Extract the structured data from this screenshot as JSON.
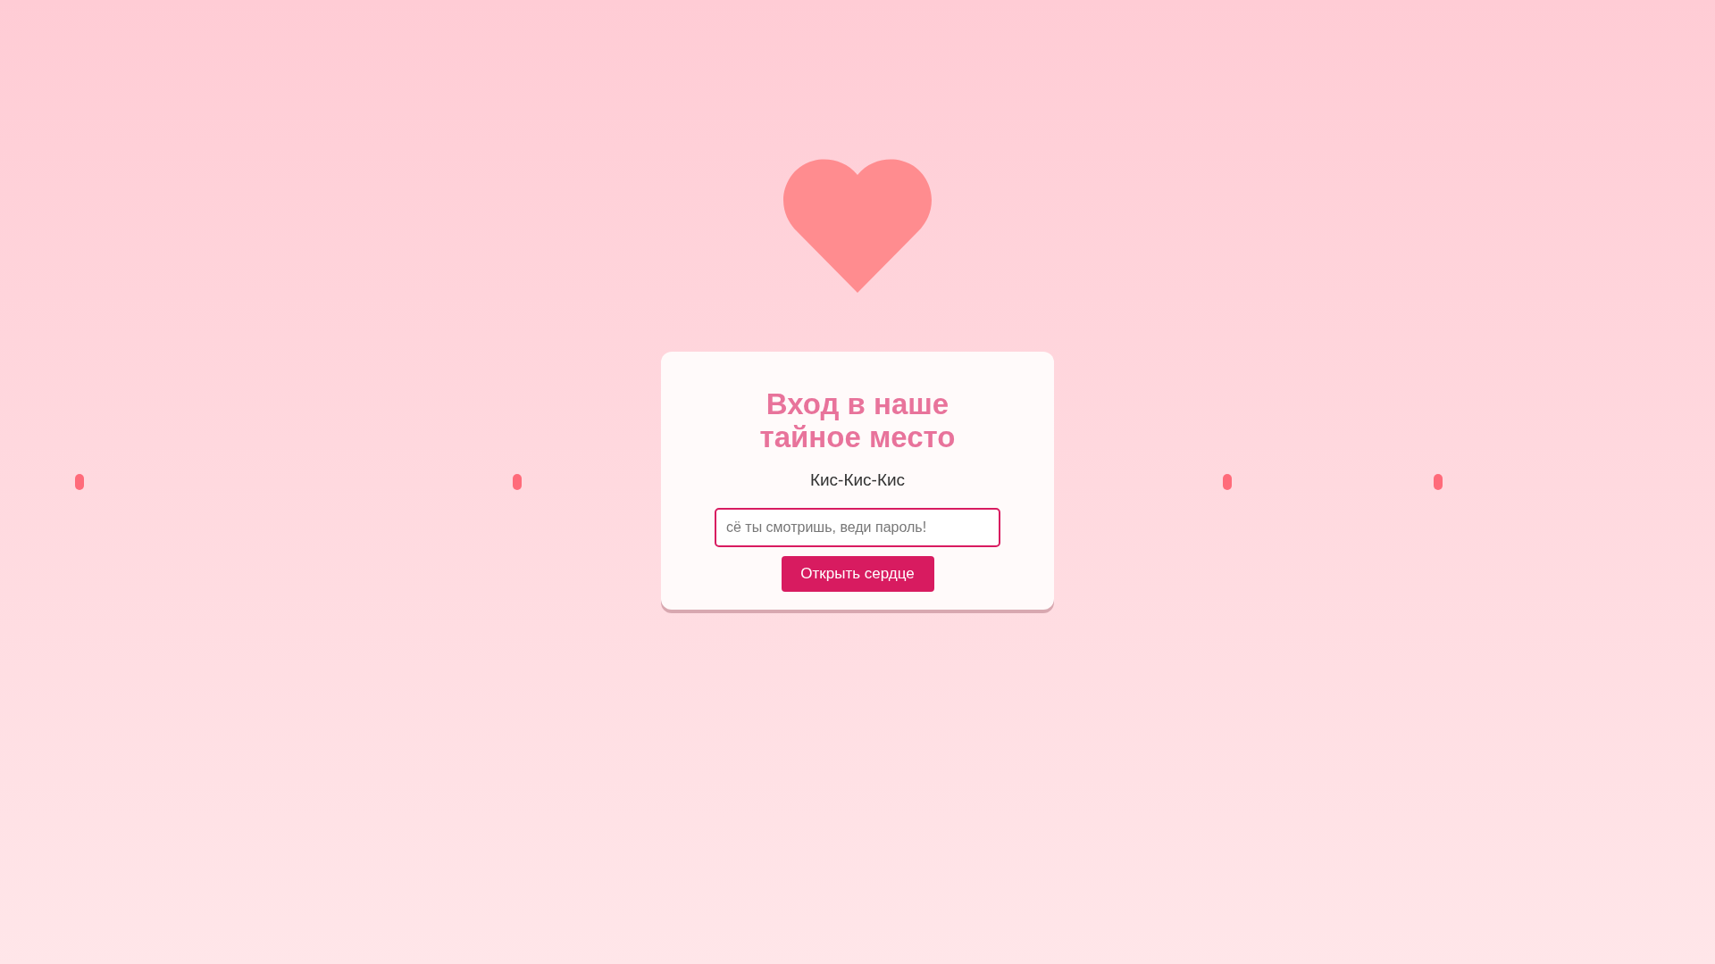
{
  "login_card": {
    "title": "Вход в наше тайное место",
    "subtitle": "Кис-Кис-Кис",
    "password_field": {
      "placeholder": "сё ты смотришь, веди пароль!"
    },
    "submit_button": "Открыть сердце"
  }
}
